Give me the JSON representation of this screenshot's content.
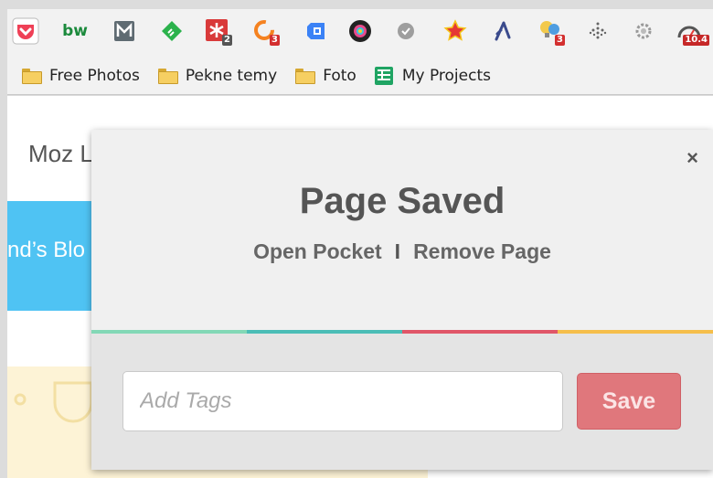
{
  "extensions": [
    {
      "name": "pocket",
      "color": "#ef4056",
      "badge": ""
    },
    {
      "name": "bw",
      "color": "#1b8a3c",
      "badge": ""
    },
    {
      "name": "gmail-m",
      "color": "#5f6b72",
      "badge": ""
    },
    {
      "name": "feedly",
      "color": "#2bb24c",
      "badge": ""
    },
    {
      "name": "asterisk",
      "color": "#d93a3a",
      "badge": "2"
    },
    {
      "name": "orange-ring",
      "color": "#f58220",
      "badge": "3"
    },
    {
      "name": "blue-box",
      "color": "#3b82f6",
      "badge": ""
    },
    {
      "name": "color-wheel",
      "color": "#222222",
      "badge": ""
    },
    {
      "name": "gray-check",
      "color": "#9e9e9e",
      "badge": ""
    },
    {
      "name": "star",
      "color": "#f5c518",
      "badge": ""
    },
    {
      "name": "fork",
      "color": "#3a4a8c",
      "badge": ""
    },
    {
      "name": "bulbs",
      "color": "#f2c94c",
      "badge": "3"
    },
    {
      "name": "dots",
      "color": "#666666",
      "badge": ""
    },
    {
      "name": "gear",
      "color": "#999999",
      "badge": ""
    },
    {
      "name": "speedometer",
      "color": "#555555",
      "badge": "10.4"
    }
  ],
  "bookmarks": [
    {
      "label": "Free Photos",
      "type": "folder"
    },
    {
      "label": "Pekne temy",
      "type": "folder"
    },
    {
      "label": "Foto",
      "type": "folder"
    },
    {
      "label": "My Projects",
      "type": "sheet"
    }
  ],
  "page": {
    "heading_partial": "Moz L",
    "banner_partial": "nd’s Blo"
  },
  "popup": {
    "close_label": "×",
    "title": "Page Saved",
    "open_link": "Open Pocket",
    "separator": "I",
    "remove_link": "Remove Page",
    "tags_placeholder": "Add Tags",
    "tags_value": "",
    "save_label": "Save",
    "stripe_colors": [
      "#83d8b6",
      "#4bbdb6",
      "#e05668",
      "#f5be4b"
    ]
  }
}
